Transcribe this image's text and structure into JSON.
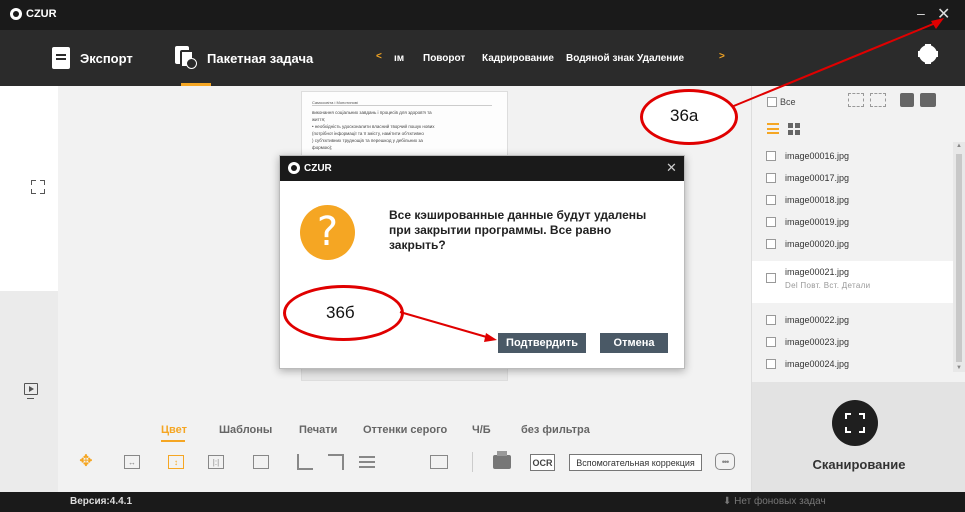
{
  "titlebar": {
    "brand": "CZUR",
    "minimize": "–",
    "close": "✕"
  },
  "toolbar": {
    "export_label": "Экспорт",
    "batch_label": "Пакетная задача",
    "menu_prev": "<",
    "menu_items": [
      "ıм",
      "Поворот",
      "Кадрирование",
      "Водяной знак",
      "Удаление"
    ],
    "menu_next": ">"
  },
  "preview": {
    "header": "Cамоосвіта і Монотипові",
    "lines": [
      "виконання соціальних завдань і процесів для здоров'я та",
      "життя;",
      "•  необхідність удосконалити власний творчий пошук нових",
      "(потрібної інформації та її змісту, намітити об'єктивно",
      ") суб'єктивних труднощів та перешкод у дебільних за",
      "формою);"
    ]
  },
  "filters": [
    "Цвет",
    "Шаблоны",
    "Печати",
    "Оттенки серого",
    "Ч/Б",
    "без фильтра"
  ],
  "tools": {
    "ocr": "OCR",
    "assist": "Вспомогательная коррекция",
    "bubble": "•••"
  },
  "right_panel": {
    "all_label": "Все",
    "files": [
      "image00016.jpg",
      "image00017.jpg",
      "image00018.jpg",
      "image00019.jpg",
      "image00020.jpg",
      "image00021.jpg",
      "image00022.jpg",
      "image00023.jpg",
      "image00024.jpg"
    ],
    "selected_actions": "Del  Повт.  Вст.  Детали",
    "scan_label": "Сканирование"
  },
  "status": {
    "version": "Версия:4.4.1",
    "tasks": "Нет фоновых задач"
  },
  "dialog": {
    "brand": "CZUR",
    "close": "✕",
    "icon": "?",
    "message": "Все кэшированные данные будут удалены при закрытии программы. Все равно закрыть?",
    "confirm": "Подтвердить",
    "cancel": "Отмена"
  },
  "annotations": {
    "a": "36а",
    "b": "36б",
    "color": "#e00000"
  }
}
